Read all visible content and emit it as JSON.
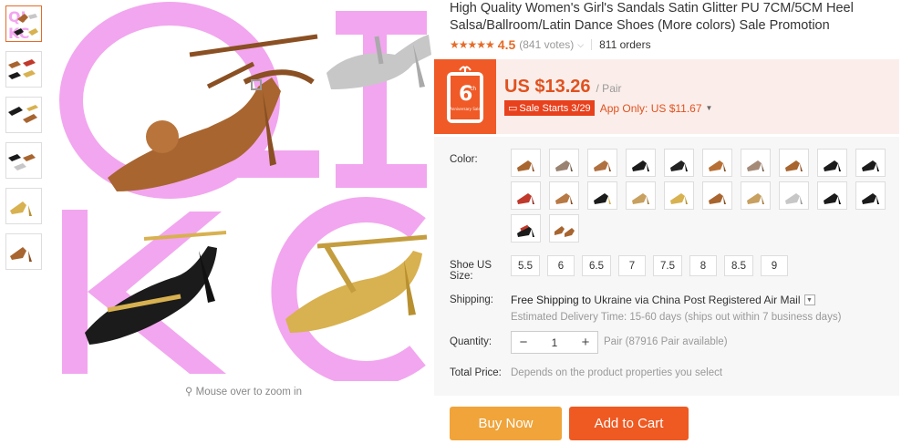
{
  "product": {
    "title": "High Quality Women's Girl's Sandals Satin Glitter PU 7CM/5CM Heel Salsa/Ballroom/Latin Dance Shoes (More colors) Sale Promotion",
    "rating_stars": "★★★★★",
    "rating_value": "4.5",
    "votes": "(841 votes)",
    "orders": "811 orders"
  },
  "gallery": {
    "zoom_hint": "Mouse over to zoom in",
    "watermark_text": "QI KC",
    "colors": {
      "watermark": "#f2a6ef",
      "tan_satin": "#a8652f",
      "black_satin": "#1b1b1b",
      "gold": "#d8b150",
      "silver": "#c7c7c7"
    }
  },
  "price": {
    "value": "US $13.26",
    "unit": "/ Pair",
    "sale_starts": "Sale Starts 3/29",
    "app_only": "App Only: US $11.67",
    "badge_number": "6",
    "badge_sup": "th",
    "badge_sub": "Anniversary Sale"
  },
  "options": {
    "color_label": "Color:",
    "size_label": "Shoe US Size:",
    "sizes": [
      "5.5",
      "6",
      "6.5",
      "7",
      "7.5",
      "8",
      "8.5",
      "9"
    ],
    "shipping_label": "Shipping:",
    "shipping_bold": "Free Shipping to",
    "shipping_rest": " Ukraine via China Post Registered Air Mail",
    "shipping_est": "Estimated Delivery Time: 15-60 days (ships out within 7 business days)",
    "quantity_label": "Quantity:",
    "quantity_value": "1",
    "quantity_avail": "Pair (87916 Pair available)",
    "total_label": "Total Price:",
    "total_note": "Depends on the product properties you select"
  },
  "actions": {
    "buy_now": "Buy Now",
    "add_to_cart": "Add to Cart"
  },
  "theme": {
    "accent": "#e56b27",
    "buy_now": "#f0a43a",
    "add_cart": "#ee5a22",
    "price": "#e0521f"
  }
}
